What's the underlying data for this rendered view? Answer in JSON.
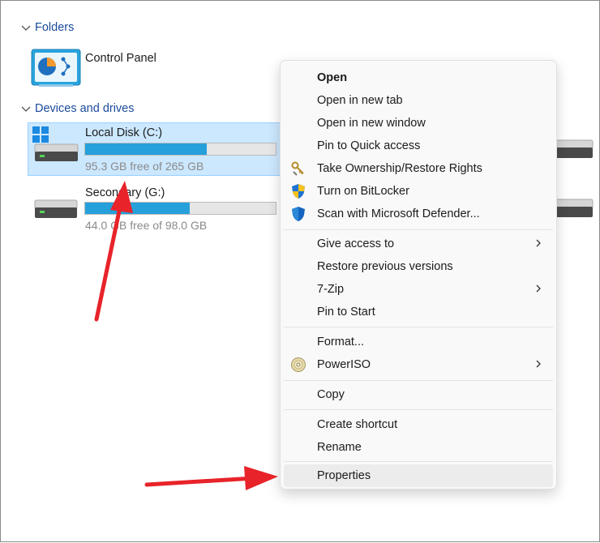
{
  "folders": {
    "header": "Folders",
    "items": [
      {
        "label": "Control Panel",
        "icon": "control-panel-icon"
      }
    ]
  },
  "devices": {
    "header": "Devices and drives",
    "drives": [
      {
        "label": "Local Disk (C:)",
        "free_text": "95.3 GB free of 265 GB",
        "used_fraction": 0.64,
        "selected": true
      },
      {
        "label": "Secondary (G:)",
        "free_text": "44.0 GB free of 98.0 GB",
        "used_fraction": 0.55,
        "selected": false
      }
    ]
  },
  "context_menu": {
    "groups": [
      [
        {
          "label": "Open",
          "bold": true
        },
        {
          "label": "Open in new tab"
        },
        {
          "label": "Open in new window"
        },
        {
          "label": "Pin to Quick access"
        },
        {
          "label": "Take Ownership/Restore Rights",
          "icon": "keys-icon"
        },
        {
          "label": "Turn on BitLocker",
          "icon": "uac-shield-icon"
        },
        {
          "label": "Scan with Microsoft Defender...",
          "icon": "defender-shield-icon"
        }
      ],
      [
        {
          "label": "Give access to",
          "submenu": true
        },
        {
          "label": "Restore previous versions"
        },
        {
          "label": "7-Zip",
          "submenu": true
        },
        {
          "label": "Pin to Start"
        }
      ],
      [
        {
          "label": "Format..."
        },
        {
          "label": "PowerISO",
          "icon": "disc-icon",
          "submenu": true
        }
      ],
      [
        {
          "label": "Copy"
        }
      ],
      [
        {
          "label": "Create shortcut"
        },
        {
          "label": "Rename"
        }
      ],
      [
        {
          "label": "Properties",
          "highlighted": true
        }
      ]
    ]
  },
  "colors": {
    "accent": "#26a0da",
    "selection": "#cce8ff",
    "annotation_arrow": "#e8232a",
    "section_header": "#1a4a9c"
  }
}
